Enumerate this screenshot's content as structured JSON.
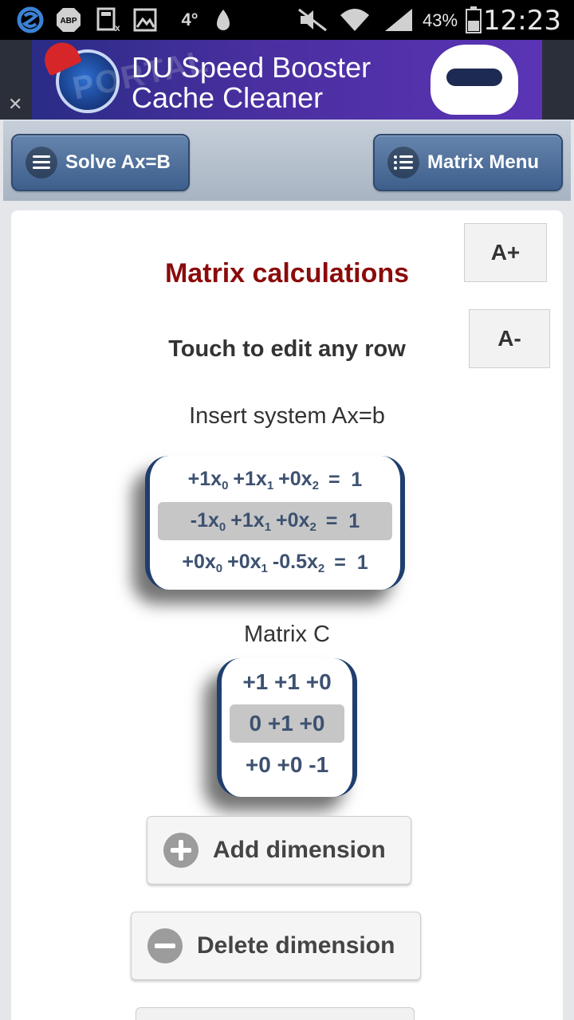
{
  "status_bar": {
    "battery_percent": "43%",
    "time": "12:23",
    "temp": "4°",
    "icons": [
      "s-app-icon",
      "adblock-icon",
      "calculator-icon",
      "image-icon",
      "temperature-icon",
      "gas-icon",
      "mute-icon",
      "wifi-icon",
      "signal-icon",
      "battery-icon"
    ]
  },
  "ad": {
    "title_line1": "DU Speed Booster",
    "title_line2": "Cache Cleaner",
    "watermark": "PORTAL"
  },
  "toolbar": {
    "left_button": "Solve Ax=B",
    "right_button": "Matrix Menu"
  },
  "content": {
    "font_increase": "A+",
    "font_decrease": "A-",
    "title": "Matrix calculations",
    "subtitle": "Touch to edit any row",
    "insert_label": "Insert system Ax=b",
    "matrix_label": "Matrix C",
    "add_button": "Add dimension",
    "delete_button": "Delete dimension"
  },
  "system_rows": [
    {
      "terms": [
        [
          "+1x",
          "0"
        ],
        [
          "+1x",
          "1"
        ],
        [
          "+0x",
          "2"
        ]
      ],
      "rhs": "=  1"
    },
    {
      "terms": [
        [
          "-1x",
          "0"
        ],
        [
          "+1x",
          "1"
        ],
        [
          "+0x",
          "2"
        ]
      ],
      "rhs": "=  1"
    },
    {
      "terms": [
        [
          "+0x",
          "0"
        ],
        [
          "+0x",
          "1"
        ],
        [
          "-0.5x",
          "2"
        ]
      ],
      "rhs": "=  1"
    }
  ],
  "selected_row": 1,
  "matrix_c": [
    "+1 +1 +0",
    "0 +1 +0",
    "+0 +0 -1"
  ]
}
